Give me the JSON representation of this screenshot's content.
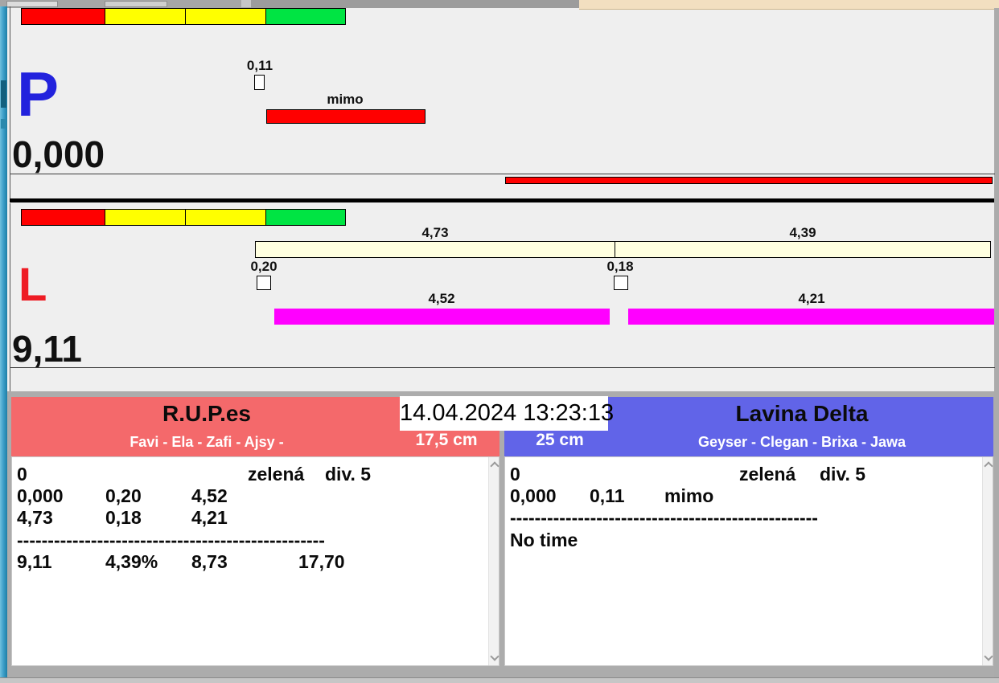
{
  "colors": {
    "red": "#ff0000",
    "yellow": "#ffff00",
    "green": "#00e443",
    "cream": "#ffffe0",
    "magenta": "#ff00ff",
    "left_header": "#f4696b",
    "right_header": "#6164e8",
    "p_letter": "#2222dd",
    "l_letter": "#ee1c24"
  },
  "p_section": {
    "label": "P",
    "value": "0,000",
    "checkbox_label": "0,11",
    "bar_label": "mimo"
  },
  "l_section": {
    "label": "L",
    "value": "9,11",
    "top_bar_labels": [
      "4,73",
      "4,39"
    ],
    "checkbox_labels": [
      "0,20",
      "0,18"
    ],
    "bottom_bar_labels": [
      "4,52",
      "4,21"
    ]
  },
  "timestamp": "14.04.2024 13:23:13",
  "left_panel": {
    "title": "R.U.P.es",
    "team": "Favi - Ela - Zafi - Ajsy -",
    "category": "17,5 cm",
    "result": {
      "faults": "0",
      "color": "zelená",
      "division": "div. 5",
      "row2": [
        "0,000",
        "0,20",
        "4,52"
      ],
      "row3": [
        "4,73",
        "0,18",
        "4,21"
      ],
      "separator": "--------------------------------------------------",
      "row5": [
        "9,11",
        "4,39%",
        "8,73",
        "17,70"
      ]
    }
  },
  "right_panel": {
    "title": "Lavina Delta",
    "team": "Geyser - Clegan - Brixa - Jawa",
    "category": "25 cm",
    "result": {
      "faults": "0",
      "color": "zelená",
      "division": "div. 5",
      "row2": [
        "0,000",
        "0,11",
        "mimo"
      ],
      "separator": "--------------------------------------------------",
      "row4": "No time"
    }
  }
}
